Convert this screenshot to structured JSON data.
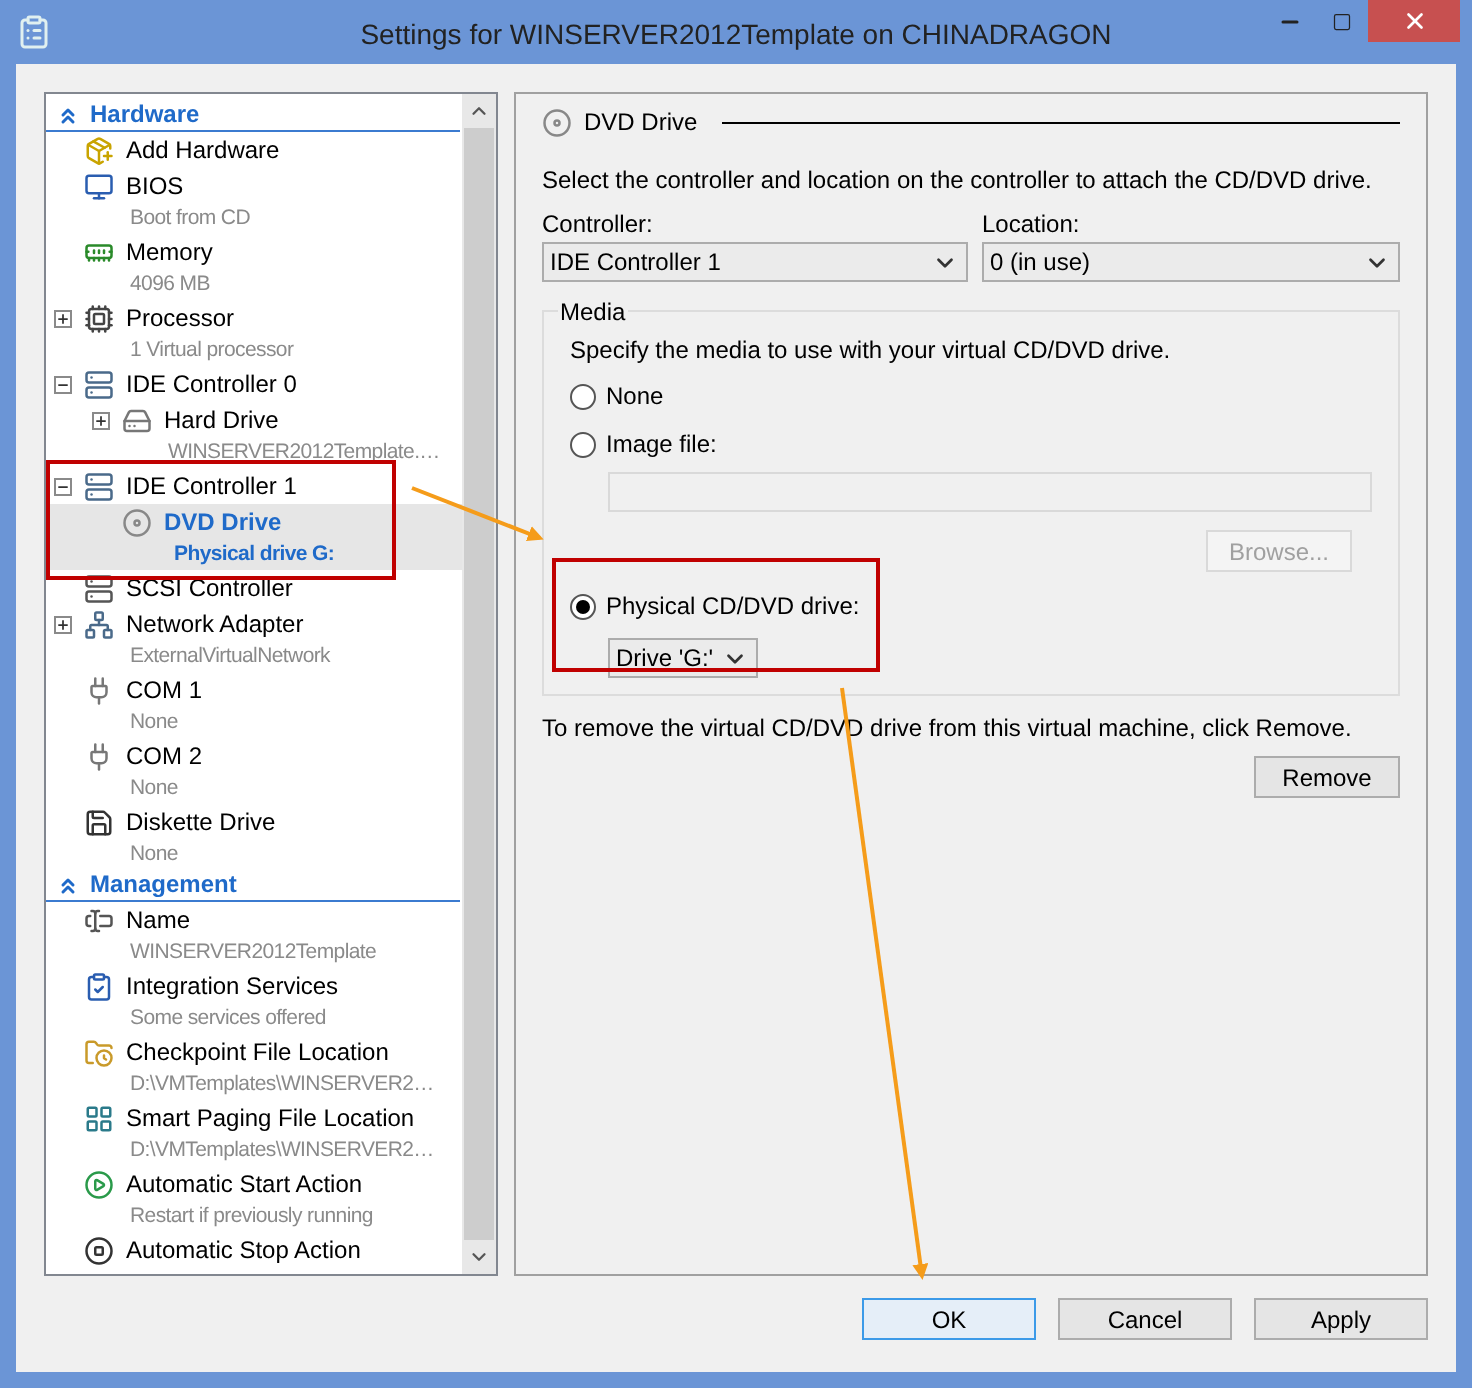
{
  "window": {
    "title": "Settings for WINSERVER2012Template on CHINADRAGON"
  },
  "sidebar": {
    "sections": [
      {
        "title": "Hardware",
        "expanded": true,
        "items": [
          {
            "label": "Add Hardware",
            "selected": false
          },
          {
            "label": "BIOS",
            "detail": "Boot from CD",
            "selected": false
          },
          {
            "label": "Memory",
            "detail": "4096 MB",
            "selected": false
          },
          {
            "label": "Processor",
            "detail": "1 Virtual processor",
            "expanded": false,
            "selected": false
          },
          {
            "label": "IDE Controller 0",
            "expanded": true,
            "selected": false,
            "children": [
              {
                "label": "Hard Drive",
                "detail": "WINSERVER2012Template.…",
                "expanded": false,
                "selected": false
              }
            ]
          },
          {
            "label": "IDE Controller 1",
            "expanded": true,
            "selected": false,
            "children": [
              {
                "label": "DVD Drive",
                "detail": "Physical drive G:",
                "selected": true
              }
            ]
          },
          {
            "label": "SCSI Controller",
            "selected": false
          },
          {
            "label": "Network Adapter",
            "detail": "ExternalVirtualNetwork",
            "expanded": false,
            "selected": false
          },
          {
            "label": "COM 1",
            "detail": "None",
            "selected": false
          },
          {
            "label": "COM 2",
            "detail": "None",
            "selected": false
          },
          {
            "label": "Diskette Drive",
            "detail": "None",
            "selected": false
          }
        ]
      },
      {
        "title": "Management",
        "expanded": true,
        "items": [
          {
            "label": "Name",
            "detail": "WINSERVER2012Template",
            "selected": false
          },
          {
            "label": "Integration Services",
            "detail": "Some services offered",
            "selected": false
          },
          {
            "label": "Checkpoint File Location",
            "detail": "D:\\VMTemplates\\WINSERVER2…",
            "selected": false
          },
          {
            "label": "Smart Paging File Location",
            "detail": "D:\\VMTemplates\\WINSERVER2…",
            "selected": false
          },
          {
            "label": "Automatic Start Action",
            "detail": "Restart if previously running",
            "selected": false
          },
          {
            "label": "Automatic Stop Action",
            "selected": false
          }
        ]
      }
    ]
  },
  "panel": {
    "title": "DVD Drive",
    "intro": "Select the controller and location on the controller to attach the CD/DVD drive.",
    "controller": {
      "label": "Controller:",
      "value": "IDE Controller 1"
    },
    "location": {
      "label": "Location:",
      "value": "0 (in use)"
    },
    "media": {
      "title": "Media",
      "hint": "Specify the media to use with your virtual CD/DVD drive.",
      "options": [
        {
          "label": "None",
          "selected": false
        },
        {
          "label": "Image file:",
          "selected": false
        },
        {
          "label": "Physical CD/DVD drive:",
          "selected": true
        }
      ],
      "browse": {
        "label": "Browse...",
        "disabled": true
      },
      "drive": {
        "value": "Drive 'G:'"
      }
    },
    "remove_hint": "To remove the virtual CD/DVD drive from this virtual machine, click Remove.",
    "remove_button": "Remove"
  },
  "buttons": [
    {
      "label": "OK",
      "focused": true
    },
    {
      "label": "Cancel",
      "focused": false
    },
    {
      "label": "Apply",
      "focused": false
    }
  ]
}
